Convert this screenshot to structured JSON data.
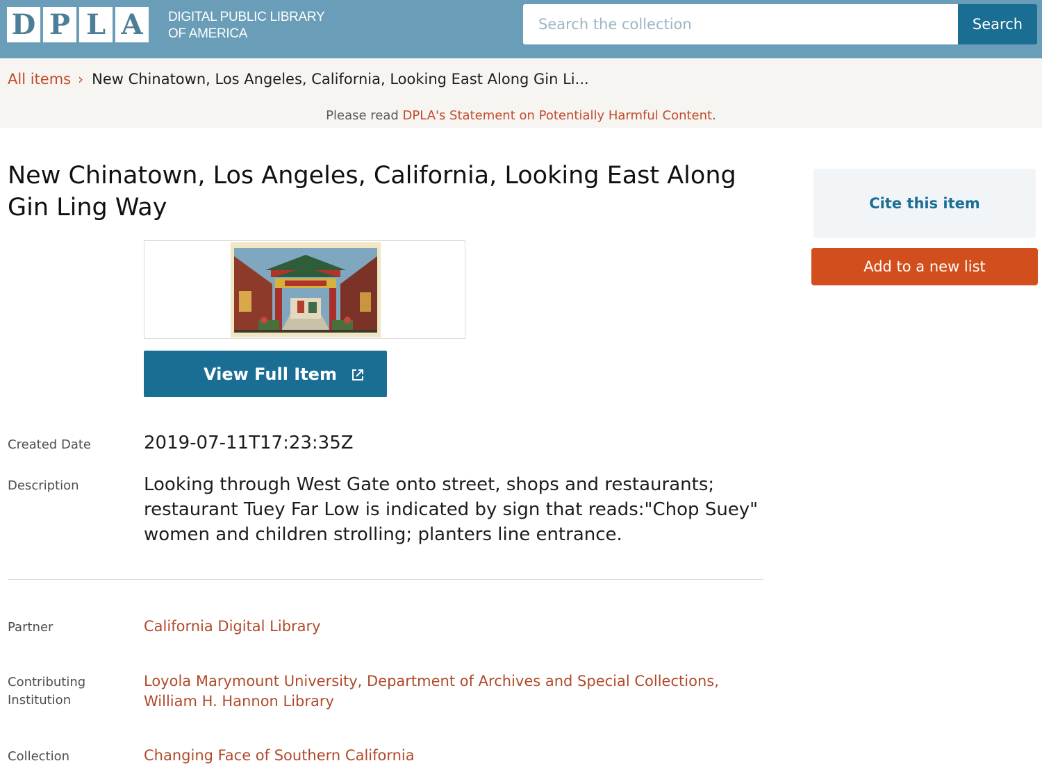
{
  "header": {
    "logo_letters": [
      "D",
      "P",
      "L",
      "A"
    ],
    "tagline_line1": "Digital Public Library",
    "tagline_line2": "of America",
    "search_placeholder": "Search the collection",
    "search_button": "Search"
  },
  "breadcrumb": {
    "root": "All items",
    "current": "New Chinatown, Los Angeles, California, Looking East Along Gin Li..."
  },
  "notice": {
    "prefix": "Please read ",
    "link": "DPLA's Statement on Potentially Harmful Content",
    "suffix": "."
  },
  "item": {
    "title": "New Chinatown, Los Angeles, California, Looking East Along Gin Ling Way",
    "view_button": "View Full Item",
    "view_icon": "external-link-icon",
    "thumbnail_icon": "postcard-image"
  },
  "metadata": {
    "created_label": "Created Date",
    "created_value": "2019-07-11T17:23:35Z",
    "description_label": "Description",
    "description_value": "Looking through West Gate onto street, shops and restaurants; restaurant Tuey Far Low is indicated by sign that reads:\"Chop Suey\" women and children strolling; planters line entrance.",
    "partner_label": "Partner",
    "partner_value": "California Digital Library",
    "contributing_label_1": "Contributing",
    "contributing_label_2": "Institution",
    "contributing_value": "Loyola Marymount University, Department of Archives and Special Collections, William H. Hannon Library",
    "collection_label": "Collection",
    "collection_value": "Changing Face of Southern California"
  },
  "sidebar": {
    "cite_label": "Cite this item",
    "add_list_label": "Add to a new list"
  },
  "colors": {
    "header_bg": "#6a9db8",
    "primary_blue": "#1a6e94",
    "link_red": "#c14a2c",
    "add_button": "#d24e1c"
  }
}
